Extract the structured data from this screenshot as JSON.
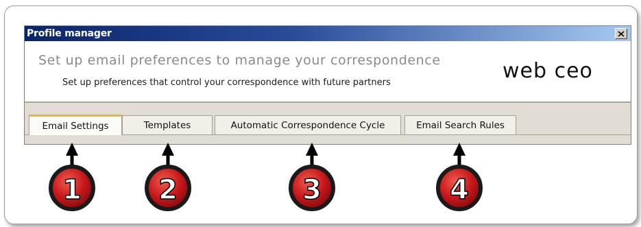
{
  "window": {
    "title": "Profile manager",
    "close_glyph": "✕"
  },
  "header": {
    "title": "Set up email preferences to manage your correspondence",
    "subtitle": "Set up preferences that control your correspondence with future partners",
    "logo_text": "web ceo"
  },
  "tabs": [
    {
      "label": "Email Settings",
      "active": true
    },
    {
      "label": "Templates",
      "active": false
    },
    {
      "label": "Automatic Correspondence Cycle",
      "active": false
    },
    {
      "label": "Email Search Rules",
      "active": false
    }
  ],
  "callouts": [
    {
      "number": "1"
    },
    {
      "number": "2"
    },
    {
      "number": "3"
    },
    {
      "number": "4"
    }
  ],
  "colors": {
    "callout_red": "#c8181b",
    "active_tab_accent": "#f0b43a",
    "titlebar_start": "#0a246a",
    "titlebar_end": "#a6caf0"
  },
  "icons": {
    "close": "close-icon",
    "arrow": "arrow-up-icon"
  }
}
